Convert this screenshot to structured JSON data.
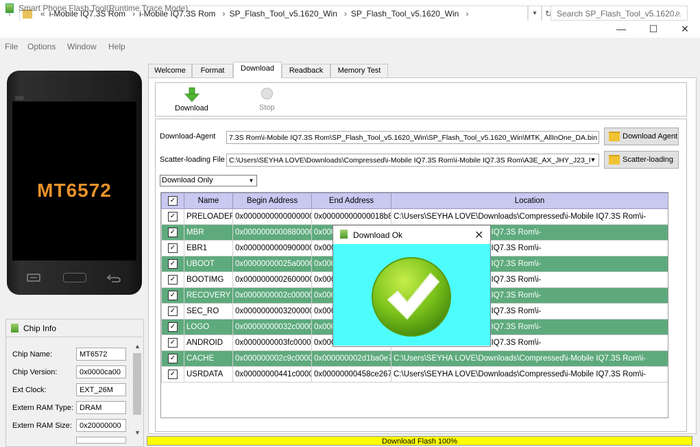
{
  "explorer": {
    "breadcrumbs": [
      "i-Mobile IQ7.3S Rom",
      "i-Mobile IQ7.3S Rom",
      "SP_Flash_Tool_v5.1620_Win",
      "SP_Flash_Tool_v5.1620_Win"
    ],
    "search_placeholder": "Search SP_Flash_Tool_v5.1620..."
  },
  "window": {
    "title": "Smart Phone Flash Tool(Runtime Trace Mode)",
    "minimize": "—",
    "maximize": "☐",
    "close": "✕"
  },
  "menu": [
    "File",
    "Options",
    "Window",
    "Help"
  ],
  "phone": {
    "brand": "BM",
    "chip": "MT6572"
  },
  "chip_info": {
    "title": "Chip Info",
    "rows": [
      {
        "label": "Chip Name:",
        "value": "MT6572"
      },
      {
        "label": "Chip Version:",
        "value": "0x0000ca00"
      },
      {
        "label": "Ext Clock:",
        "value": "EXT_26M"
      },
      {
        "label": "Extern RAM Type:",
        "value": "DRAM"
      },
      {
        "label": "Extern RAM Size:",
        "value": "0x20000000"
      }
    ]
  },
  "tabs": [
    {
      "label": "Welcome"
    },
    {
      "label": "Format"
    },
    {
      "label": "Download",
      "active": true
    },
    {
      "label": "Readback"
    },
    {
      "label": "Memory Test"
    }
  ],
  "toolbar": {
    "download_label": "Download",
    "stop_label": "Stop"
  },
  "download_agent": {
    "label": "Download-Agent",
    "value": "7.3S Rom\\i-Mobile IQ7.3S Rom\\SP_Flash_Tool_v5.1620_Win\\SP_Flash_Tool_v5.1620_Win\\MTK_AllInOne_DA.bin",
    "button": "Download Agent"
  },
  "scatter": {
    "label": "Scatter-loading File",
    "value": "C:\\Users\\SEYHA LOVE\\Downloads\\Compressed\\i-Mobile IQ7.3S Rom\\i-Mobile IQ7.3S Rom\\A3E_AX_JHY_J23_I",
    "button": "Scatter-loading"
  },
  "mode_select": "Download Only",
  "table": {
    "headers": [
      "",
      "Name",
      "Begin Address",
      "End Address",
      "Location"
    ],
    "rows": [
      {
        "name": "PRELOADER",
        "begin": "0x0000000000000000",
        "end": "0x00000000000018b8f",
        "loc": "C:\\Users\\SEYHA LOVE\\Downloads\\Compressed\\i-Mobile IQ7.3S Rom\\i-",
        "hl": false
      },
      {
        "name": "MBR",
        "begin": "0x0000000000880000",
        "end": "0x000",
        "loc": "loads\\Compressed\\i-Mobile IQ7.3S Rom\\i-",
        "hl": true
      },
      {
        "name": "EBR1",
        "begin": "0x0000000000900000",
        "end": "0x000",
        "loc": "loads\\Compressed\\i-Mobile IQ7.3S Rom\\i-",
        "hl": false
      },
      {
        "name": "UBOOT",
        "begin": "0x00000000025a0000",
        "end": "0x000",
        "loc": "loads\\Compressed\\i-Mobile IQ7.3S Rom\\i-",
        "hl": true
      },
      {
        "name": "BOOTIMG",
        "begin": "0x0000000002600000",
        "end": "0x000",
        "loc": "loads\\Compressed\\i-Mobile IQ7.3S Rom\\i-",
        "hl": false
      },
      {
        "name": "RECOVERY",
        "begin": "0x0000000002c00000",
        "end": "0x000",
        "loc": "loads\\Compressed\\i-Mobile IQ7.3S Rom\\i-",
        "hl": true
      },
      {
        "name": "SEC_RO",
        "begin": "0x0000000003200000",
        "end": "0x000",
        "loc": "loads\\Compressed\\i-Mobile IQ7.3S Rom\\i-",
        "hl": false
      },
      {
        "name": "LOGO",
        "begin": "0x00000000032c0000",
        "end": "0x000",
        "loc": "loads\\Compressed\\i-Mobile IQ7.3S Rom\\i-",
        "hl": true
      },
      {
        "name": "ANDROID",
        "begin": "0x0000000003fc0000",
        "end": "0x000",
        "loc": "loads\\Compressed\\i-Mobile IQ7.3S Rom\\i-",
        "hl": false
      },
      {
        "name": "CACHE",
        "begin": "0x000000002c9c0000",
        "end": "0x000000002d1ba0e7",
        "loc": "C:\\Users\\SEYHA LOVE\\Downloads\\Compressed\\i-Mobile IQ7.3S Rom\\i-",
        "hl": true
      },
      {
        "name": "USRDATA",
        "begin": "0x00000000441c0000",
        "end": "0x00000000458ce267",
        "loc": "C:\\Users\\SEYHA LOVE\\Downloads\\Compressed\\i-Mobile IQ7.3S Rom\\i-",
        "hl": false
      }
    ]
  },
  "status": {
    "text": "Download Flash 100%",
    "color": "#ffff00"
  },
  "dialog": {
    "title": "Download Ok",
    "close": "✕",
    "body_color": "#4dfdfd"
  },
  "colors": {
    "highlight_row": "#5eaa7d",
    "header": "#c8c8f0",
    "chip_text": "#e8922a"
  }
}
